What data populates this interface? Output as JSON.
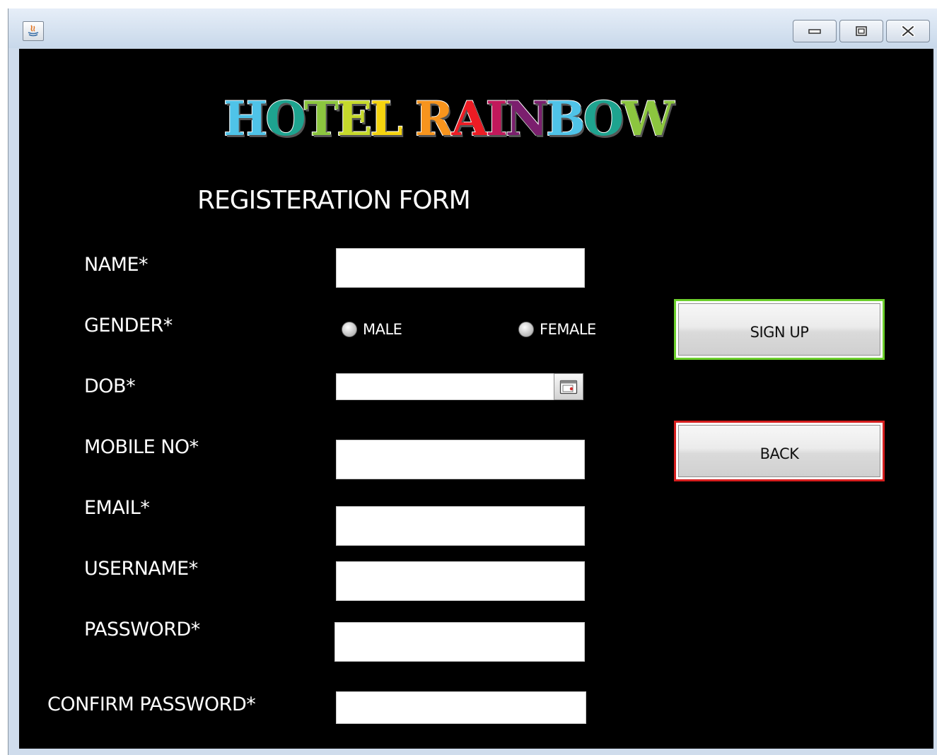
{
  "window": {
    "buttons": {
      "minimize": "minimize-icon",
      "maximize": "maximize-icon",
      "close": "close-icon"
    },
    "app_icon": "java-icon"
  },
  "logo": {
    "text": "HOTEL RAINBOW",
    "letters": [
      {
        "ch": "H",
        "color": "#4fc3e8"
      },
      {
        "ch": "O",
        "color": "#1ea38f"
      },
      {
        "ch": "T",
        "color": "#8cc63f"
      },
      {
        "ch": "E",
        "color": "#c6d92b"
      },
      {
        "ch": "L",
        "color": "#f5d40f"
      },
      {
        "ch": " ",
        "color": "#000000"
      },
      {
        "ch": "R",
        "color": "#f7941d"
      },
      {
        "ch": "A",
        "color": "#ed1c24"
      },
      {
        "ch": "I",
        "color": "#c2185b"
      },
      {
        "ch": "N",
        "color": "#7b1f6e"
      },
      {
        "ch": "B",
        "color": "#4fc3e8"
      },
      {
        "ch": "O",
        "color": "#1ea38f"
      },
      {
        "ch": "W",
        "color": "#8cc63f"
      }
    ]
  },
  "form": {
    "title": "REGISTERATION FORM",
    "labels": {
      "name": "NAME*",
      "gender": "GENDER*",
      "dob": "DOB*",
      "mobile": "MOBILE NO*",
      "email": "EMAIL*",
      "username": "USERNAME*",
      "password": "PASSWORD*",
      "confirm_password": "CONFIRM PASSWORD*"
    },
    "values": {
      "name": "",
      "dob": "",
      "mobile": "",
      "email": "",
      "username": "",
      "password": "",
      "confirm_password": ""
    },
    "gender_options": {
      "male": "MALE",
      "female": "FEMALE",
      "selected": null
    },
    "calendar_icon": "calendar-icon"
  },
  "actions": {
    "signup_label": "SIGN UP",
    "signup_accent": "#6ccf2c",
    "back_label": "BACK",
    "back_accent": "#d61f1f"
  }
}
